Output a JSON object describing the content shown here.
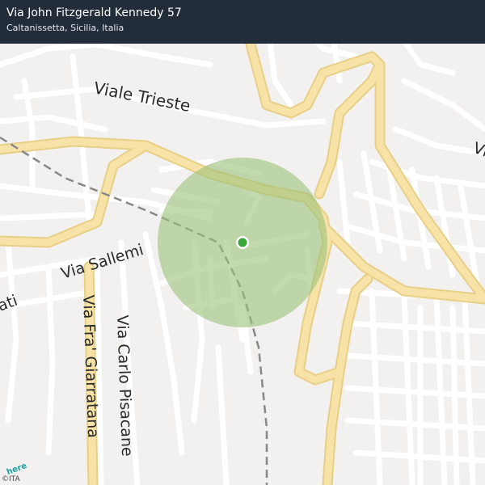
{
  "header": {
    "address": "Via John Fitzgerald Kennedy 57",
    "locality": "Caltanissetta, Sicilia, Italia"
  },
  "map": {
    "street_labels": {
      "viale_trieste": "Viale Trieste",
      "via_sallemi": "Via Sallemi",
      "via_fra_giarratana": "Via Fra' Giarratana",
      "via_carlo_pisacane": "Via Carlo Pisacane",
      "partial_left": "ati",
      "partial_right": "Vi"
    },
    "colors": {
      "background": "#f2f1ef",
      "minor_road": "#ffffff",
      "major_road": "#f7e3a8",
      "major_road_edge": "#e8cf86",
      "accuracy_circle": "#9bc27a",
      "location_dot": "#3aa63a",
      "railway": "#888888"
    }
  },
  "footer": {
    "logo": "here",
    "credit": "©ITA"
  }
}
